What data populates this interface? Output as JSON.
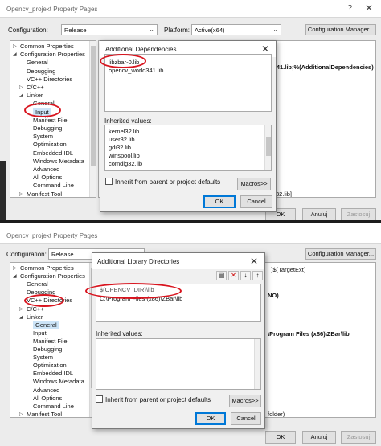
{
  "top": {
    "title": "Opencv_projekt Property Pages",
    "help": "?",
    "close": "✕",
    "config_label": "Configuration:",
    "config_value": "Release",
    "platform_label": "Platform:",
    "platform_value": "Active(x64)",
    "config_manager": "Configuration Manager...",
    "tree": [
      "Common Properties",
      "Configuration Properties",
      "General",
      "Debugging",
      "VC++ Directories",
      "C/C++",
      "Linker",
      "General",
      "Input",
      "Manifest File",
      "Debugging",
      "System",
      "Optimization",
      "Embedded IDL",
      "Windows Metadata",
      "Advanced",
      "All Options",
      "Command Line",
      "Manifest Tool"
    ],
    "grid_value1": "ld341.lib;%(AdditionalDependencies)",
    "grid_value2": "32.lib]",
    "ok": "OK",
    "cancel": "Anuluj",
    "apply": "Zastosuj",
    "dialog": {
      "title": "Additional Dependencies",
      "help": "?",
      "close": "✕",
      "entries": [
        "libzbar-0.lib",
        "opencv_world341.lib"
      ],
      "inherited_label": "Inherited values:",
      "inherited": [
        "kernel32.lib",
        "user32.lib",
        "gdi32.lib",
        "winspool.lib",
        "comdlg32.lib"
      ],
      "inherit_check": "Inherit from parent or project defaults",
      "macros": "Macros>>",
      "ok": "OK",
      "cancel": "Cancel"
    }
  },
  "bottom": {
    "title": "Opencv_projekt Property Pages",
    "config_label": "Configuration:",
    "config_value": "Release",
    "config_manager": "Configuration Manager...",
    "tree": [
      "Common Properties",
      "Configuration Properties",
      "General",
      "Debugging",
      "VC++ Directories",
      "C/C++",
      "Linker",
      "General",
      "Input",
      "Manifest File",
      "Debugging",
      "System",
      "Optimization",
      "Embedded IDL",
      "Windows Metadata",
      "Advanced",
      "All Options",
      "Command Line",
      "Manifest Tool"
    ],
    "grid_values": [
      ")$(TargetExt)",
      "NO)",
      "\\Program Files (x86)\\ZBar\\lib",
      "folder)"
    ],
    "ok": "OK",
    "cancel": "Anuluj",
    "apply": "Zastosuj",
    "dialog": {
      "title": "Additional Library Directories",
      "help": "?",
      "close": "✕",
      "entries": [
        "$(OPENCV_DIR)\\lib",
        "C:\\Program Files (x86)\\ZBar\\lib"
      ],
      "inherited_label": "Inherited values:",
      "inherit_check": "Inherit from parent or project defaults",
      "macros": "Macros>>",
      "ok": "OK",
      "cancel": "Cancel"
    }
  },
  "colors": {
    "highlight": "#d8141e",
    "selection": "#cce4f7"
  }
}
